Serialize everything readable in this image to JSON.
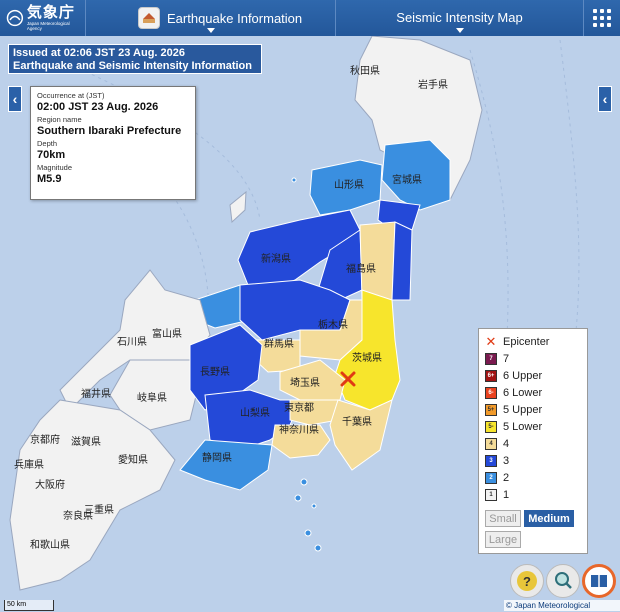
{
  "header": {
    "logo_jp": "気象庁",
    "logo_en": "Japan Meteorological Agency",
    "tab_earthquake": "Earthquake Information",
    "tab_map": "Seismic Intensity Map"
  },
  "issued": {
    "line1": "Issued at 02:06 JST 23 Aug. 2026",
    "line2": "Earthquake and Seismic Intensity Information"
  },
  "info": {
    "occurrence_key": "Occurrence at (JST)",
    "occurrence_val": "02:00 JST 23 Aug. 2026",
    "region_key": "Region name",
    "region_val": "Southern Ibaraki Prefecture",
    "depth_key": "Depth",
    "depth_val": "70km",
    "mag_key": "Magnitude",
    "mag_val": "M5.9"
  },
  "legend": {
    "epicenter": "Epicenter",
    "items": [
      {
        "badge": "7",
        "label": "7",
        "color": "#7a1a4f"
      },
      {
        "badge": "6+",
        "label": "6 Upper",
        "color": "#a11414"
      },
      {
        "badge": "6-",
        "label": "6 Lower",
        "color": "#e9421f"
      },
      {
        "badge": "5+",
        "label": "5 Upper",
        "color": "#f19a2a"
      },
      {
        "badge": "5-",
        "label": "5 Lower",
        "color": "#f7e52c"
      },
      {
        "badge": "4",
        "label": "4",
        "color": "#f4dc9a"
      },
      {
        "badge": "3",
        "label": "3",
        "color": "#2449d8"
      },
      {
        "badge": "2",
        "label": "2",
        "color": "#3a8fe0"
      },
      {
        "badge": "1",
        "label": "1",
        "color": "#f2f2f2"
      }
    ],
    "size_small": "Small",
    "size_medium": "Medium",
    "size_large": "Large"
  },
  "map_labels": {
    "akita": "秋田県",
    "iwate": "岩手県",
    "yamagata": "山形県",
    "miyagi": "宮城県",
    "niigata": "新潟県",
    "fukushima": "福島県",
    "toyama": "富山県",
    "ishikawa": "石川県",
    "gunma": "群馬県",
    "tochigi": "栃木県",
    "ibaraki": "茨城県",
    "nagano": "長野県",
    "saitama": "埼玉県",
    "fukui": "福井県",
    "gifu": "岐阜県",
    "yamanashi": "山梨県",
    "tokyo": "東京都",
    "chiba": "千葉県",
    "kanagawa": "神奈川県",
    "kyoto": "京都府",
    "shiga": "滋賀県",
    "aichi": "愛知県",
    "shizuoka": "静岡県",
    "hyogo": "兵庫県",
    "nara": "奈良県",
    "mie": "三重県",
    "wakayama": "和歌山県",
    "osaka": "大阪府"
  },
  "footer": {
    "scale": "50 km",
    "copyright": "© Japan Meteorological Agency"
  },
  "colors": {
    "header": "#2a5fa5",
    "sea": "#bcd0ea",
    "int4": "#f4dc9a",
    "int5lower": "#f7e52c",
    "int3": "#2449d8",
    "int2": "#3a8fe0",
    "int1": "#f2f2f2",
    "epicenter": "#e03a14"
  }
}
